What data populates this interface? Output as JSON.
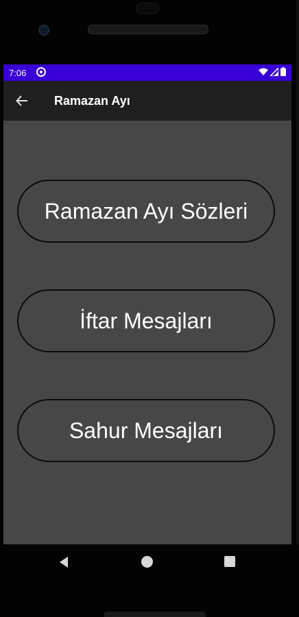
{
  "status_bar": {
    "time": "7:06",
    "background_color": "#3800d6",
    "icons": [
      "app-notification-icon",
      "wifi-icon",
      "signal-icon",
      "battery-icon"
    ]
  },
  "toolbar": {
    "title": "Ramazan Ayı",
    "back_icon": "arrow-left-icon",
    "background_color": "#1f1f1f"
  },
  "main": {
    "background_color": "#474747",
    "buttons": [
      {
        "label": "Ramazan Ayı Sözleri"
      },
      {
        "label": "İftar Mesajları"
      },
      {
        "label": "Sahur Mesajları"
      }
    ]
  },
  "navigation_bar": {
    "items": [
      "back-icon",
      "home-icon",
      "recent-apps-icon"
    ]
  }
}
